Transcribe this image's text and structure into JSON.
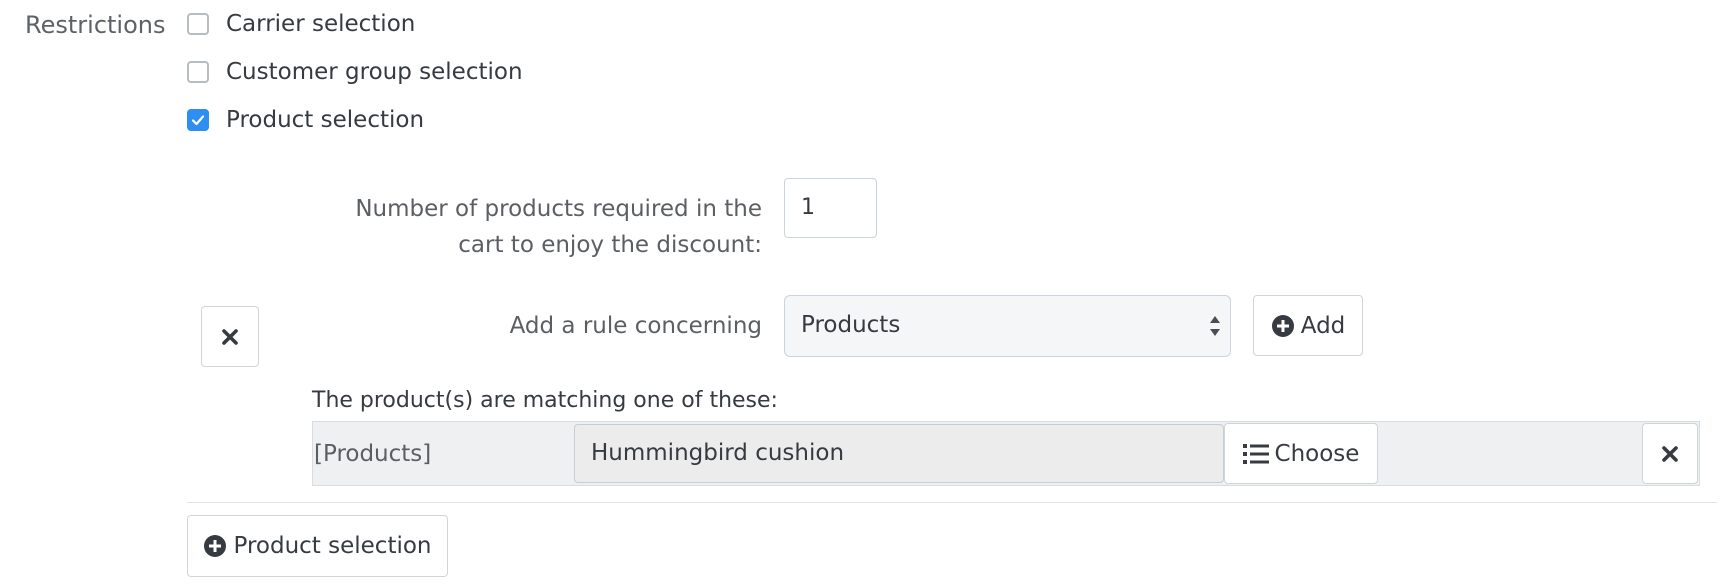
{
  "restrictions": {
    "label": "Restrictions",
    "options": [
      {
        "label": "Carrier selection",
        "checked": false
      },
      {
        "label": "Customer group selection",
        "checked": false
      },
      {
        "label": "Product selection",
        "checked": true
      }
    ]
  },
  "product_rules": {
    "quantity_label_line1": "Number of products required in the",
    "quantity_label_line2": "cart to enjoy the discount:",
    "quantity_value": "1",
    "rule_label": "Add a rule concerning",
    "rule_select_value": "Products",
    "add_button_label": "Add",
    "matching_label": "The product(s) are matching one of these:",
    "rule_type_label": "[Products]",
    "selected_product": "Hummingbird cushion",
    "choose_button_label": "Choose",
    "add_product_selection_label": "Product selection"
  },
  "colors": {
    "accent": "#2f8ef2",
    "text": "#363a41",
    "muted": "#5e6266"
  },
  "icons": [
    "checkmark-icon",
    "close-icon",
    "plus-circle-icon",
    "list-icon",
    "select-arrows-icon"
  ]
}
